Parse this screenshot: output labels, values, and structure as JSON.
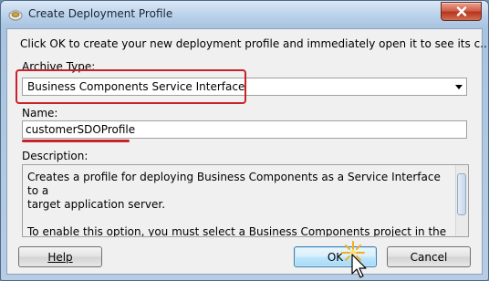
{
  "window": {
    "title": "Create Deployment Profile",
    "icon": "oracle-jdev-app-icon",
    "close_icon": "close-icon"
  },
  "intro": "Click OK to create your new deployment profile and immediately open it to see its c...",
  "archive_type": {
    "label": "Archive Type:",
    "selected": "Business Components Service Interface"
  },
  "name": {
    "label": "Name:",
    "value": "customerSDOProfile"
  },
  "description": {
    "label": "Description:",
    "text": "Creates a profile for deploying Business Components as a Service Interface to a\ntarget application server.\n\nTo enable this option, you must select a Business Components project in the\nApplication Navigator."
  },
  "buttons": {
    "help": "Help",
    "ok": "OK",
    "cancel": "Cancel"
  },
  "colors": {
    "annotation_red": "#c8222a",
    "default_button_blue": "#3c7fb1"
  }
}
